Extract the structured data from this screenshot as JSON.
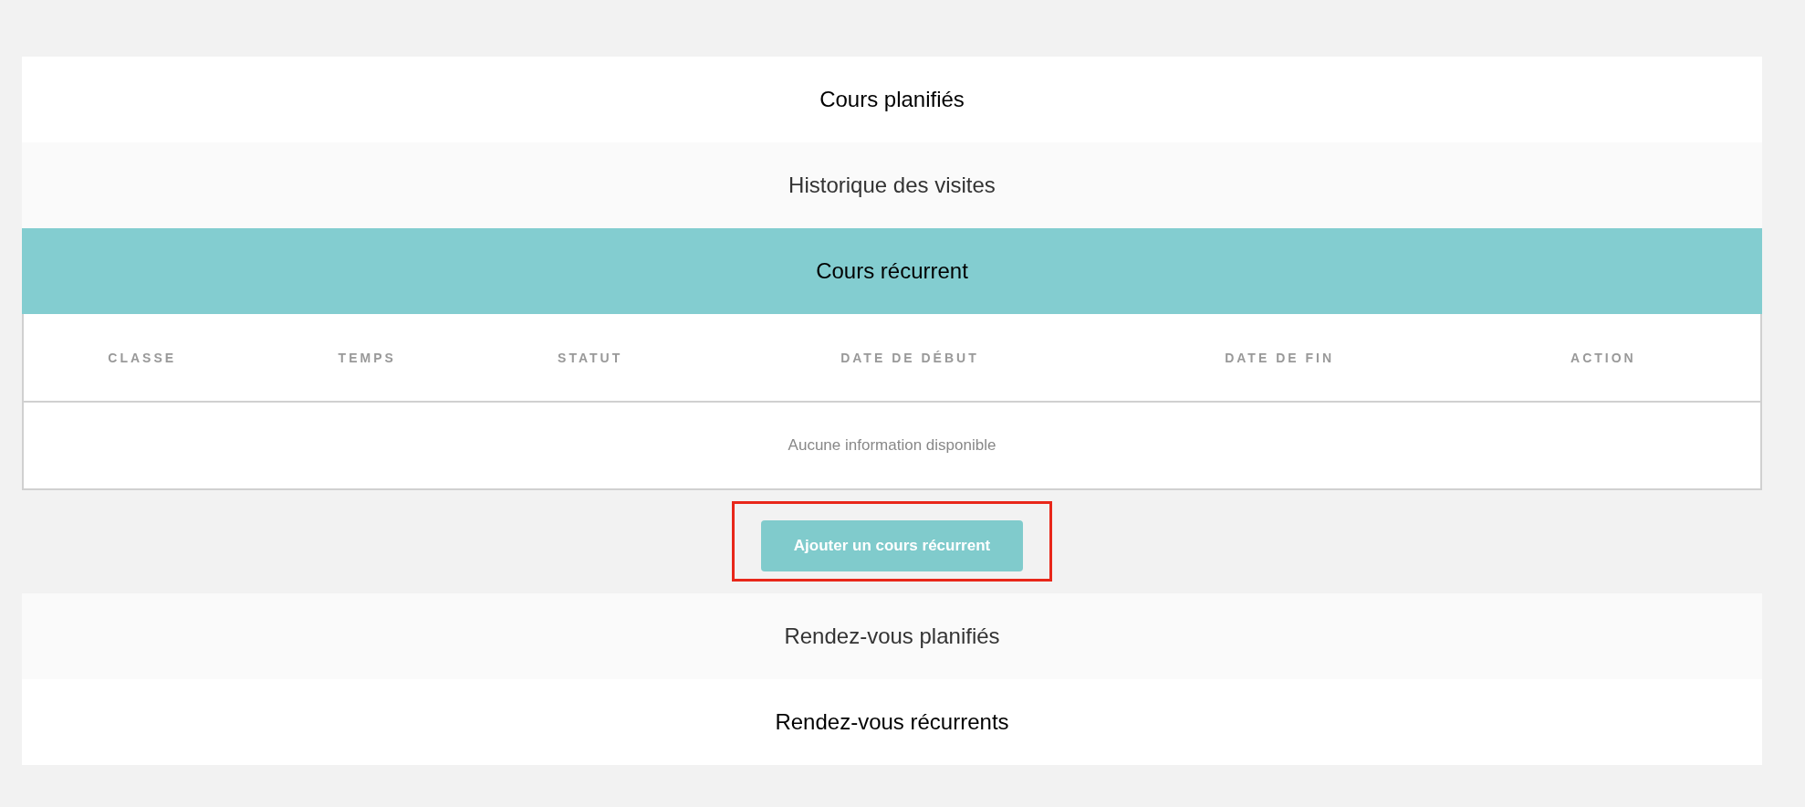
{
  "sections": [
    {
      "title": "Cours planifiés",
      "expanded": false
    },
    {
      "title": "Historique des visites",
      "expanded": false
    },
    {
      "title": "Cours récurrent",
      "expanded": true,
      "table": {
        "columns": [
          "CLASSE",
          "TEMPS",
          "STATUT",
          "DATE DE DÉBUT",
          "DATE DE FIN",
          "ACTION"
        ],
        "empty_message": "Aucune information disponible"
      },
      "button": {
        "label": "Ajouter un cours récurrent",
        "highlighted": true
      }
    },
    {
      "title": "Rendez-vous planifiés",
      "expanded": false
    },
    {
      "title": "Rendez-vous récurrents",
      "expanded": false
    }
  ]
}
